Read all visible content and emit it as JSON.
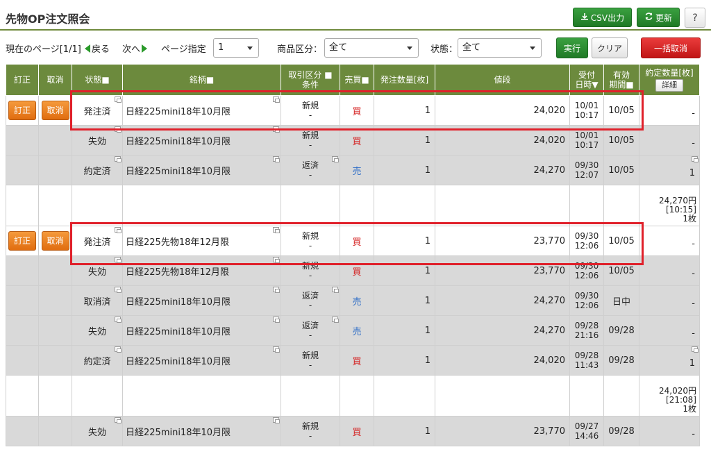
{
  "header": {
    "title": "先物OP注文照会",
    "csv_label": "CSV出力",
    "refresh_label": "更新",
    "help_label": "?"
  },
  "toolbar": {
    "page_info": "現在のページ[1/1]",
    "prev_label": "戻る",
    "next_label": "次へ",
    "page_select_label": "ページ指定",
    "page_value": "1",
    "product_label": "商品区分：",
    "product_value": "全て",
    "status_label": "状態：",
    "status_value": "全て",
    "execute_label": "実行",
    "clear_label": "クリア",
    "cancel_all_label": "一括取消"
  },
  "columns": {
    "correct": "訂正",
    "cancel": "取消",
    "status": "状態■",
    "symbol": "銘柄■",
    "trade_type_1": "取引区分 ■",
    "trade_type_2": "条件",
    "side": "売買■",
    "qty": "発注数量[枚]",
    "price": "値段",
    "recv_1": "受付",
    "recv_2": "日時▼",
    "expiry_1": "有効",
    "expiry_2": "期間■",
    "filled_qty": "約定数量[枚]",
    "detail": "詳細"
  },
  "row_buttons": {
    "correct": "訂正",
    "cancel": "取消"
  },
  "rows": [
    {
      "status": "発注済",
      "symbol": "日経225mini18年10月限",
      "trade_1": "新規",
      "trade_2": "-",
      "side": "買",
      "qty": "1",
      "price": "24,020",
      "date": "10/01",
      "time": "10:17",
      "expiry": "10/05",
      "filled": "-"
    },
    {
      "status": "失効",
      "symbol": "日経225mini18年10月限",
      "trade_1": "新規",
      "trade_2": "-",
      "side": "買",
      "qty": "1",
      "price": "24,020",
      "date": "10/01",
      "time": "10:17",
      "expiry": "10/05",
      "filled": "-"
    },
    {
      "status": "約定済",
      "symbol": "日経225mini18年10月限",
      "trade_1": "返済",
      "trade_2": "-",
      "side": "売",
      "qty": "1",
      "price": "24,270",
      "date": "09/30",
      "time": "12:07",
      "expiry": "10/05",
      "filled": "1"
    },
    {
      "sum_1": "24,270円",
      "sum_2": "[10:15]",
      "sum_3": "1枚"
    },
    {
      "status": "発注済",
      "symbol": "日経225先物18年12月限",
      "trade_1": "新規",
      "trade_2": "-",
      "side": "買",
      "qty": "1",
      "price": "23,770",
      "date": "09/30",
      "time": "12:06",
      "expiry": "10/05",
      "filled": "-"
    },
    {
      "status": "失効",
      "symbol": "日経225先物18年12月限",
      "trade_1": "新規",
      "trade_2": "-",
      "side": "買",
      "qty": "1",
      "price": "23,770",
      "date": "09/30",
      "time": "12:06",
      "expiry": "10/05",
      "filled": "-"
    },
    {
      "status": "取消済",
      "symbol": "日経225mini18年10月限",
      "trade_1": "返済",
      "trade_2": "-",
      "side": "売",
      "qty": "1",
      "price": "24,270",
      "date": "09/30",
      "time": "12:06",
      "expiry": "日中",
      "filled": "-"
    },
    {
      "status": "失効",
      "symbol": "日経225mini18年10月限",
      "trade_1": "返済",
      "trade_2": "-",
      "side": "売",
      "qty": "1",
      "price": "24,270",
      "date": "09/28",
      "time": "21:16",
      "expiry": "09/28",
      "filled": "-"
    },
    {
      "status": "約定済",
      "symbol": "日経225mini18年10月限",
      "trade_1": "新規",
      "trade_2": "-",
      "side": "買",
      "qty": "1",
      "price": "24,020",
      "date": "09/28",
      "time": "11:43",
      "expiry": "09/28",
      "filled": "1"
    },
    {
      "sum_1": "24,020円",
      "sum_2": "[21:08]",
      "sum_3": "1枚"
    },
    {
      "status": "失効",
      "symbol": "日経225mini18年10月限",
      "trade_1": "新規",
      "trade_2": "-",
      "side": "買",
      "qty": "1",
      "price": "23,770",
      "date": "09/27",
      "time": "14:46",
      "expiry": "09/28",
      "filled": "-"
    }
  ],
  "colors": {
    "header_green": "#6c8a3d",
    "buy_red": "#d42020",
    "sell_blue": "#2c6cc6",
    "highlight_red": "#e0202a",
    "orange_button": "#e06d10"
  }
}
